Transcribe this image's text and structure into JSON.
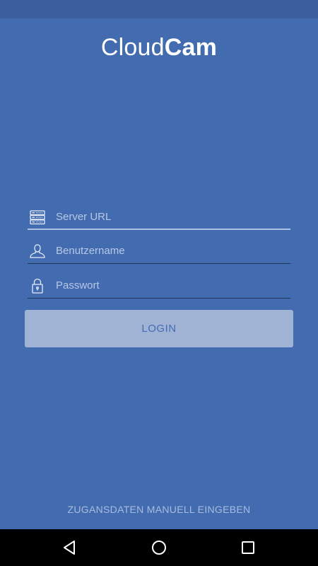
{
  "app": {
    "logo_light": "Cloud",
    "logo_bold": "Cam"
  },
  "form": {
    "server_placeholder": "Server URL",
    "user_placeholder": "Benutzername",
    "password_placeholder": "Passwort",
    "login_label": "LOGIN"
  },
  "footer": {
    "manual_link": "ZUGANSDATEN MANUELL EINGEBEN"
  },
  "icons": {
    "server": "server-icon",
    "user": "user-icon",
    "lock": "lock-icon",
    "back": "back-icon",
    "home": "home-icon",
    "recent": "recent-apps-icon"
  },
  "colors": {
    "background": "#436cb0",
    "status_bar": "#3a5e9e",
    "button": "#a1b3d5",
    "text": "#ffffff"
  }
}
